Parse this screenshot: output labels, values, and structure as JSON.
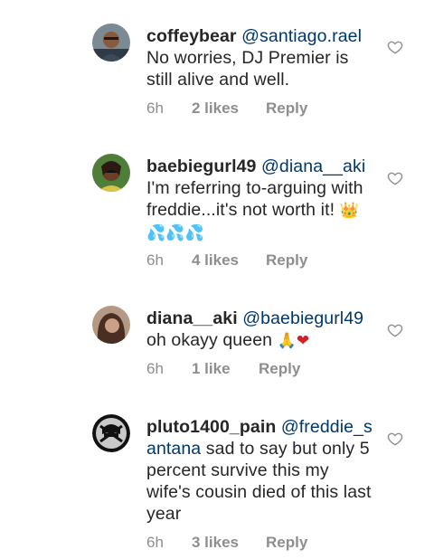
{
  "comments": [
    {
      "username": "coffeybear",
      "mention": "@santiago.rael",
      "text": "No worries, DJ Premier is still alive and well.",
      "time": "6h",
      "likes": "2 likes",
      "reply": "Reply",
      "avatar": "avatar-man-glasses",
      "like_icon": "heart-outline-icon"
    },
    {
      "username": "baebiegurl49",
      "mention": "@diana__aki",
      "text": "I'm referring to-arguing with freddie...it's not worth it!",
      "emojis": "👑💦💦💦",
      "time": "6h",
      "likes": "4 likes",
      "reply": "Reply",
      "avatar": "avatar-woman-sunglasses",
      "like_icon": "heart-outline-icon"
    },
    {
      "username": "diana__aki",
      "mention": "@baebiegurl49",
      "text": "oh okayy queen",
      "emojis": "🙏❤",
      "time": "6h",
      "likes": "1 like",
      "reply": "Reply",
      "avatar": "avatar-woman-hair",
      "like_icon": "heart-outline-icon"
    },
    {
      "username": "pluto1400_pain",
      "mention": "@freddie_santana",
      "text": "sad to say but only 5 percent survive this my wife's  cousin died of this last year",
      "time": "6h",
      "likes": "3 likes",
      "reply": "Reply",
      "avatar": "avatar-raiders-logo",
      "like_icon": "heart-outline-icon"
    }
  ],
  "colors": {
    "text": "#262626",
    "mention": "#00376b",
    "meta": "#8e8e8e"
  }
}
